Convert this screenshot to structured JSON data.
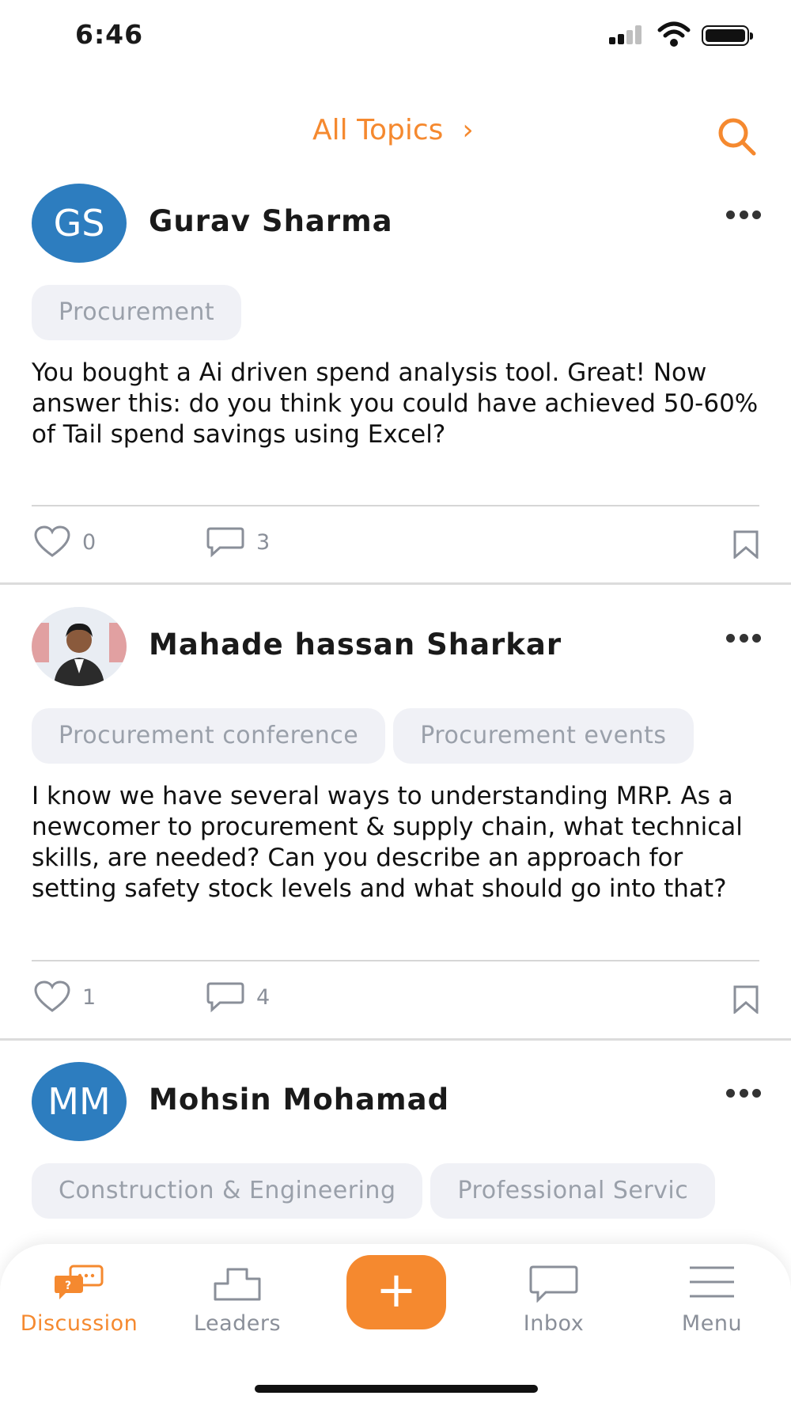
{
  "status": {
    "time": "6:46"
  },
  "header": {
    "topics_label": "All Topics",
    "chevron": "›",
    "accent_color": "#f5892f"
  },
  "posts": [
    {
      "avatar_initials": "GS",
      "author": "Gurav Sharma",
      "tags": [
        "Procurement"
      ],
      "body": "You bought a Ai driven spend analysis tool. Great! Now answer this: do you think you could have achieved 50-60% of Tail spend savings using Excel?",
      "likes": "0",
      "comments": "3"
    },
    {
      "avatar_initials": "",
      "author": "Mahade hassan Sharkar",
      "tags": [
        "Procurement conference",
        "Procurement events"
      ],
      "body": "I know we have several ways to understanding MRP. As a newcomer to procurement & supply chain, what technical skills, are needed? Can you describe an approach for setting safety stock levels and what should go into that?",
      "likes": "1",
      "comments": "4"
    },
    {
      "avatar_initials": "MM",
      "author": "Mohsin Mohamad",
      "tags": [
        "Construction & Engineering",
        "Professional Servic"
      ]
    }
  ],
  "nav": {
    "items": [
      {
        "label": "Discussion",
        "icon": "discussion-icon"
      },
      {
        "label": "Leaders",
        "icon": "leaders-icon"
      },
      {
        "label": "+",
        "icon": "add-icon"
      },
      {
        "label": "Inbox",
        "icon": "inbox-icon"
      },
      {
        "label": "Menu",
        "icon": "menu-icon"
      }
    ]
  }
}
